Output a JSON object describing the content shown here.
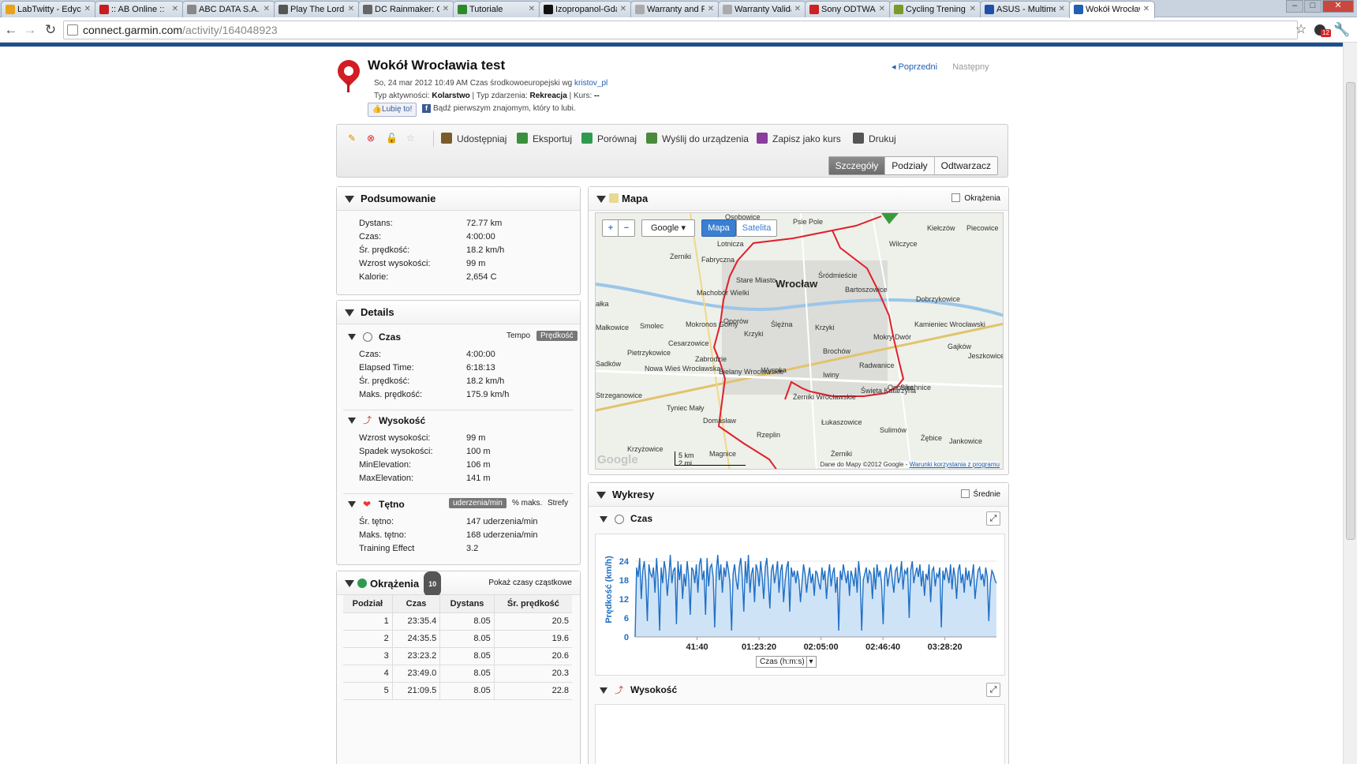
{
  "browser": {
    "tabs": [
      {
        "label": "LabTwitty - Edyc",
        "fav": "#e8a31b"
      },
      {
        "label": ":: AB Online ::",
        "fav": "#c41e1e"
      },
      {
        "label": "ABC DATA S.A.",
        "fav": "#888888"
      },
      {
        "label": "Play The Lord of",
        "fav": "#555555"
      },
      {
        "label": "DC Rainmaker: C",
        "fav": "#666666"
      },
      {
        "label": "Tutoriale",
        "fav": "#2c8a2c"
      },
      {
        "label": "Izopropanol-Gda",
        "fav": "#111111"
      },
      {
        "label": "Warranty and Re",
        "fav": "#aaaaaa"
      },
      {
        "label": "Warranty Validat",
        "fav": "#aaaaaa"
      },
      {
        "label": "Sony ODTWARZ",
        "fav": "#cc2222"
      },
      {
        "label": "Cycling Trening",
        "fav": "#7a9a2a"
      },
      {
        "label": "ASUS - Multime",
        "fav": "#1f4fa8"
      },
      {
        "label": "Wokół Wrocławi",
        "fav": "#1f5fb4",
        "active": true
      }
    ],
    "url_host": "connect.garmin.com",
    "url_path": "/activity/164048923",
    "ext_badge": "12"
  },
  "activity": {
    "title": "Wokół Wrocławia test",
    "meta_date": "So, 24 mar 2012 10:49 AM Czas środkowoeuropejski wg",
    "meta_user": "kristov_pl",
    "type_label": "Typ aktywności:",
    "type_value": "Kolarstwo",
    "event_label": "| Typ zdarzenia:",
    "event_value": "Rekreacja",
    "course_label": "| Kurs:",
    "course_value": "--",
    "prev": "Poprzedni",
    "next": "Następny",
    "like_btn": "Lubię to!",
    "like_text": "Bądź pierwszym znajomym, który to lubi."
  },
  "toolbar": {
    "share": "Udostępniaj",
    "export": "Eksportuj",
    "compare": "Porównaj",
    "send": "Wyślij do urządzenia",
    "save_course": "Zapisz jako kurs",
    "print": "Drukuj",
    "view_tabs": [
      "Szczegóły",
      "Podziały",
      "Odtwarzacz"
    ]
  },
  "summary": {
    "title": "Podsumowanie",
    "rows": [
      {
        "k": "Dystans:",
        "v": "72.77 km"
      },
      {
        "k": "Czas:",
        "v": "4:00:00"
      },
      {
        "k": "Śr. prędkość:",
        "v": "18.2 km/h"
      },
      {
        "k": "Wzrost wysokości:",
        "v": "99 m"
      },
      {
        "k": "Kalorie:",
        "v": "2,654 C"
      }
    ]
  },
  "details": {
    "title": "Details",
    "time": {
      "title": "Czas",
      "tempo": "Tempo",
      "speed": "Prędkość",
      "rows": [
        {
          "k": "Czas:",
          "v": "4:00:00"
        },
        {
          "k": "Elapsed Time:",
          "v": "6:18:13"
        },
        {
          "k": "Śr. prędkość:",
          "v": "18.2 km/h"
        },
        {
          "k": "Maks. prędkość:",
          "v": "175.9 km/h"
        }
      ]
    },
    "elev": {
      "title": "Wysokość",
      "rows": [
        {
          "k": "Wzrost wysokości:",
          "v": "99 m"
        },
        {
          "k": "Spadek wysokości:",
          "v": "100 m"
        },
        {
          "k": "MinElevation:",
          "v": "106 m"
        },
        {
          "k": "MaxElevation:",
          "v": "141 m"
        }
      ]
    },
    "hr": {
      "title": "Tętno",
      "chip1": "uderzenia/min",
      "chip2": "% maks.",
      "chip3": "Strefy",
      "rows": [
        {
          "k": "Śr. tętno:",
          "v": "147 uderzenia/min"
        },
        {
          "k": "Maks. tętno:",
          "v": "168 uderzenia/min"
        },
        {
          "k": "Training Effect",
          "v": "3.2"
        }
      ]
    }
  },
  "laps": {
    "title": "Okrążenia",
    "count": "10",
    "toggle": "Pokaż czasy cząstkowe",
    "headers": [
      "Podział",
      "Czas",
      "Dystans",
      "Śr. prędkość"
    ],
    "rows": [
      [
        "1",
        "23:35.4",
        "8.05",
        "20.5"
      ],
      [
        "2",
        "24:35.5",
        "8.05",
        "19.6"
      ],
      [
        "3",
        "23:23.2",
        "8.05",
        "20.6"
      ],
      [
        "4",
        "23:49.0",
        "8.05",
        "20.3"
      ],
      [
        "5",
        "21:09.5",
        "8.05",
        "22.8"
      ]
    ]
  },
  "map": {
    "title": "Mapa",
    "laps_cb": "Okrążenia",
    "provider": "Google",
    "mode_map": "Mapa",
    "mode_sat": "Satelita",
    "city": "Wrocław",
    "places": [
      "Osobowice",
      "Psie Pole",
      "Kiełczów",
      "Piecowice",
      "Wilczyce",
      "Zerniki",
      "Fabryczna",
      "Lotnicza",
      "Stare Miasto",
      "Śródmieście",
      "Bartoszowice",
      "Machobór Wielki",
      "Dobrzykowice",
      "ałka",
      "Małkowice",
      "Smolec",
      "Mokronos Górny",
      "Oporów",
      "Krzyki",
      "Kamieniec Wrocławski",
      "Mokry Dwór",
      "Gajków",
      "Pietrzykowice",
      "Cesarzowice",
      "Brochów",
      "Jeszkowice",
      "Sadków",
      "Nowa Wieś Wrocławska",
      "Zabrodzie",
      "Bielany Wrocławskie",
      "Wysoka",
      "Iwiny",
      "Radwanice",
      "Siechnice",
      "Strzeganowice",
      "Żerniki Wrocławskie",
      "Święta Katarzyna",
      "Tyniec Mały",
      "Domasław",
      "Łukaszowice",
      "Żerniki",
      "Krzyżowice",
      "Rzeplin",
      "Sulimów",
      "Żębice",
      "Jankowice",
      "Magnice",
      "Opolska",
      "Ślężna",
      "Krzyki"
    ],
    "scale_km": "5 km",
    "scale_mi": "2 mi",
    "copyright": "Dane do Mapy ©2012 Google -",
    "terms": "Warunki korzystania z programu",
    "logo": "Google"
  },
  "charts": {
    "title": "Wykresy",
    "avg_cb": "Średnie",
    "time_title": "Czas",
    "elev_title": "Wysokość",
    "x_selector": "Czas (h:m:s)"
  },
  "chart_data": {
    "type": "area",
    "title": "",
    "xlabel": "",
    "ylabel": "Prędkość (km/h)",
    "xticks": [
      "41:40",
      "01:23:20",
      "02:05:00",
      "02:46:40",
      "03:28:20"
    ],
    "yticks": [
      0,
      6,
      12,
      18,
      24
    ],
    "ylim": [
      0,
      30
    ],
    "xlim_min": [
      0,
      243
    ],
    "x_tick_min": [
      41.67,
      83.33,
      125,
      166.67,
      208.33
    ],
    "series": [
      {
        "values": [
          0,
          22,
          19,
          25,
          12,
          21,
          24,
          18,
          5,
          23,
          20,
          19,
          22,
          14,
          25,
          18,
          2,
          22,
          17,
          24,
          21,
          13,
          19,
          26,
          17,
          21,
          22,
          4,
          24,
          18,
          23,
          12,
          20,
          16,
          24,
          19,
          7,
          22,
          21,
          17,
          23,
          14,
          23,
          25,
          18,
          21,
          7,
          25,
          16,
          22,
          23,
          19,
          3,
          21,
          26,
          18,
          23,
          14,
          22,
          19,
          24,
          21,
          17,
          2,
          20,
          23,
          18,
          15,
          22,
          25,
          19,
          8,
          24,
          17,
          26,
          14,
          20,
          22,
          11,
          23,
          21,
          16,
          24,
          19,
          12,
          22,
          25,
          18,
          9,
          21,
          23,
          17,
          20,
          24,
          14,
          21,
          23,
          11,
          18,
          22,
          24,
          8,
          22,
          19,
          21,
          17,
          21,
          18,
          11,
          17,
          23,
          20,
          14,
          19,
          22,
          17,
          20,
          13,
          21,
          20,
          17,
          15,
          22,
          18,
          21,
          12,
          19,
          23,
          16,
          20,
          22,
          14,
          19,
          2,
          21,
          18,
          23,
          20,
          17,
          21,
          13,
          21,
          19,
          16,
          22,
          14,
          24,
          19,
          2,
          18,
          20,
          22,
          17,
          21,
          20,
          12,
          22,
          15,
          23,
          19,
          21,
          17,
          4,
          19,
          22,
          16,
          20,
          23,
          18,
          14,
          21,
          22,
          17,
          19,
          24,
          15,
          21,
          20,
          22,
          6,
          21,
          24,
          17,
          20,
          22,
          19,
          23,
          16,
          21,
          13,
          20,
          18,
          23,
          11,
          21,
          22,
          16,
          20,
          19,
          22,
          3,
          21,
          18,
          22,
          20,
          17,
          23,
          15,
          22,
          19,
          12,
          21,
          23,
          17,
          20,
          14,
          22,
          18,
          21,
          16,
          19,
          23,
          12,
          17,
          21,
          22,
          18,
          20,
          16,
          22,
          19,
          5,
          17,
          21,
          20,
          18,
          17
        ]
      }
    ]
  }
}
